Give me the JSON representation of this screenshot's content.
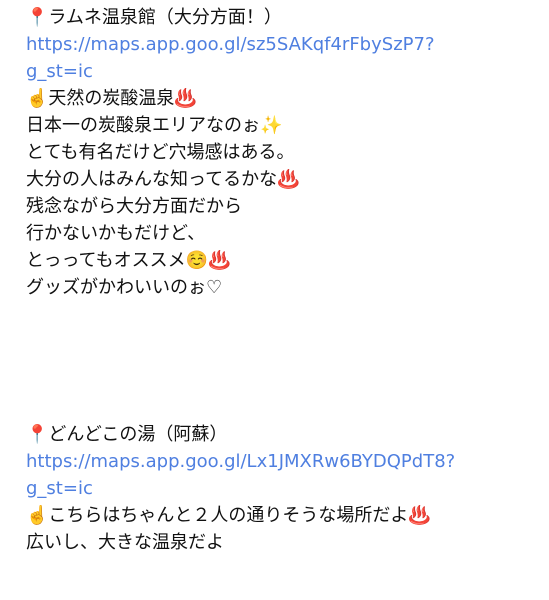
{
  "posts": [
    {
      "title_line": "📍ラムネ温泉館（大分方面！）",
      "link_text": "https://maps.app.goo.gl/sz5SAKqf4rFbySzP7?\ng_st=ic",
      "body_lines": [
        "☝️天然の炭酸温泉♨️",
        "日本一の炭酸泉エリアなのぉ✨",
        "とても有名だけど穴場感はある。",
        "大分の人はみんな知ってるかな♨️",
        "残念ながら大分方面だから",
        "行かないかもだけど、",
        "とっってもオススメ☺️♨️",
        "グッズがかわいいのぉ♡"
      ]
    },
    {
      "title_line": "📍どんどこの湯（阿蘇）",
      "link_text": "https://maps.app.goo.gl/Lx1JMXRw6BYDQPdT8?\ng_st=ic",
      "body_lines": [
        "☝️こちらはちゃんと２人の通りそうな場所だよ♨️",
        "広いし、大きな温泉だよ"
      ]
    }
  ]
}
